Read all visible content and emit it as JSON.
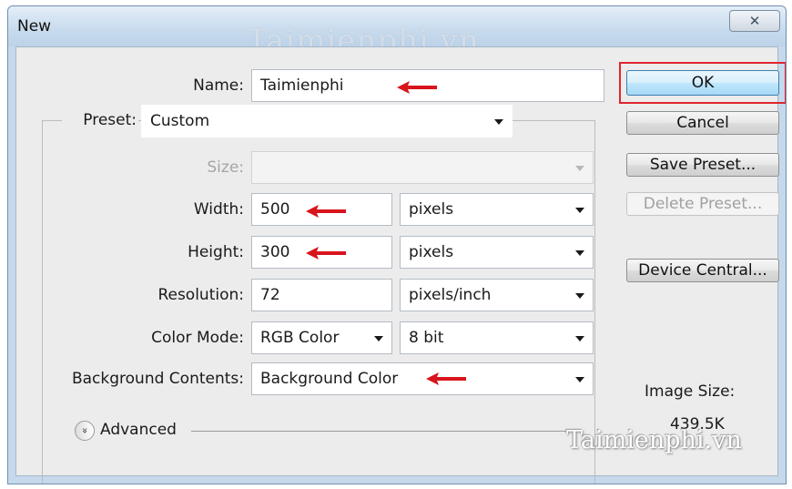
{
  "window": {
    "title": "New",
    "close_glyph": "✕",
    "watermark": "Taimienphi.vn"
  },
  "name": {
    "label": "Name:",
    "value": "Taimienphi"
  },
  "preset": {
    "label": "Preset:",
    "value": "Custom"
  },
  "size": {
    "label": "Size:",
    "value": ""
  },
  "width": {
    "label": "Width:",
    "value": "500",
    "unit": "pixels"
  },
  "height": {
    "label": "Height:",
    "value": "300",
    "unit": "pixels"
  },
  "resolution": {
    "label": "Resolution:",
    "value": "72",
    "unit": "pixels/inch"
  },
  "color_mode": {
    "label": "Color Mode:",
    "value": "RGB Color",
    "depth": "8 bit"
  },
  "background": {
    "label": "Background Contents:",
    "value": "Background Color"
  },
  "advanced": {
    "label": "Advanced",
    "icon": "chevrons-down-icon",
    "glyph": "»"
  },
  "buttons": {
    "ok": "OK",
    "cancel": "Cancel",
    "save_preset": "Save Preset...",
    "delete_preset": "Delete Preset...",
    "device_central": "Device Central..."
  },
  "image_size": {
    "label": "Image Size:",
    "value": "439.5K"
  },
  "watermark_bottom": "Taimienphi.vn",
  "colors": {
    "highlight": "#e0262e",
    "arrow": "#d8141c",
    "ok_border": "#3c7fb1"
  }
}
